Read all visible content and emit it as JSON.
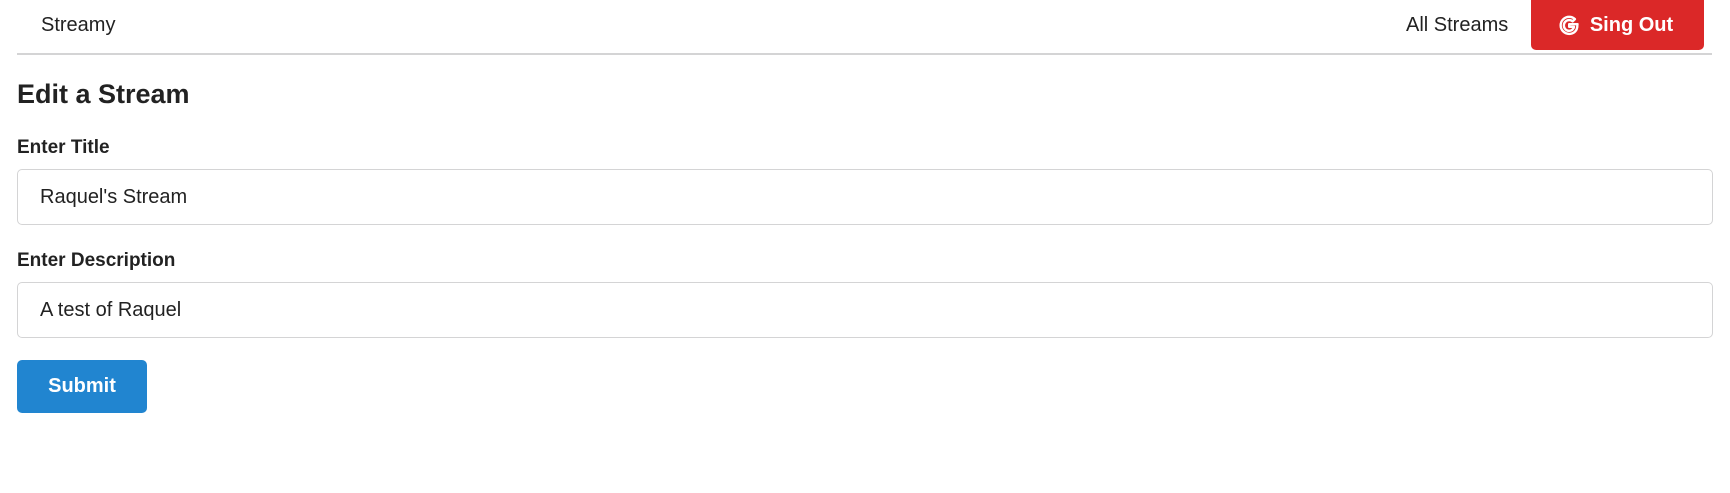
{
  "header": {
    "brand": "Streamy",
    "nav_link": "All Streams",
    "signout_label": "Sing Out",
    "signout_icon": "google-icon",
    "signout_color": "#db2828"
  },
  "form": {
    "heading": "Edit a Stream",
    "title_label": "Enter Title",
    "title_value": "Raquel's Stream",
    "description_label": "Enter Description",
    "description_value": "A test of Raquel",
    "submit_label": "Submit",
    "submit_color": "#2185d0"
  }
}
